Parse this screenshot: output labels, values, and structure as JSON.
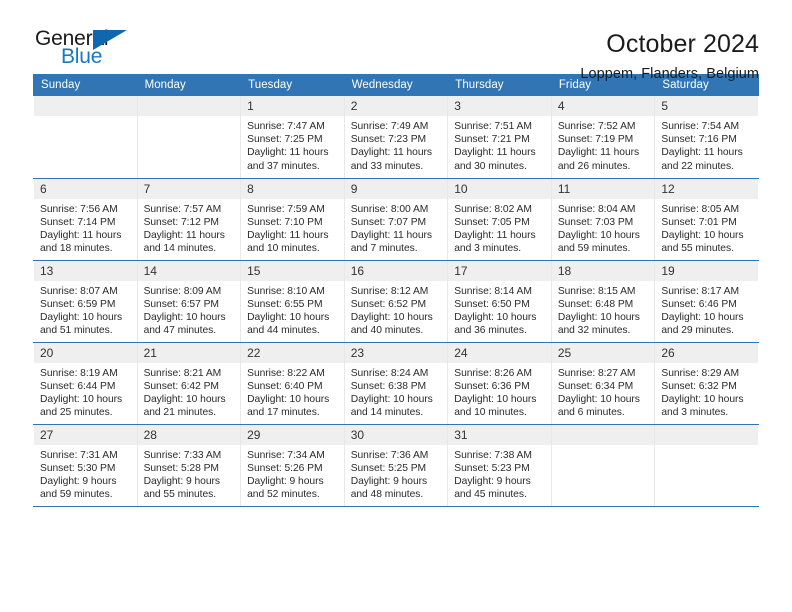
{
  "logo": {
    "word_top": "General",
    "word_bottom": "Blue",
    "triangle_color": "#1167ad",
    "blue_text_color": "#1878c8"
  },
  "header": {
    "title": "October 2024",
    "subtitle": "Loppem, Flanders, Belgium",
    "accent_color": "#3175b5"
  },
  "weekday_headers": [
    "Sunday",
    "Monday",
    "Tuesday",
    "Wednesday",
    "Thursday",
    "Friday",
    "Saturday"
  ],
  "weeks": [
    [
      {
        "day": "",
        "empty": true
      },
      {
        "day": "",
        "empty": true
      },
      {
        "day": "1",
        "sunrise": "Sunrise: 7:47 AM",
        "sunset": "Sunset: 7:25 PM",
        "daylight_1": "Daylight: 11 hours",
        "daylight_2": "and 37 minutes."
      },
      {
        "day": "2",
        "sunrise": "Sunrise: 7:49 AM",
        "sunset": "Sunset: 7:23 PM",
        "daylight_1": "Daylight: 11 hours",
        "daylight_2": "and 33 minutes."
      },
      {
        "day": "3",
        "sunrise": "Sunrise: 7:51 AM",
        "sunset": "Sunset: 7:21 PM",
        "daylight_1": "Daylight: 11 hours",
        "daylight_2": "and 30 minutes."
      },
      {
        "day": "4",
        "sunrise": "Sunrise: 7:52 AM",
        "sunset": "Sunset: 7:19 PM",
        "daylight_1": "Daylight: 11 hours",
        "daylight_2": "and 26 minutes."
      },
      {
        "day": "5",
        "sunrise": "Sunrise: 7:54 AM",
        "sunset": "Sunset: 7:16 PM",
        "daylight_1": "Daylight: 11 hours",
        "daylight_2": "and 22 minutes."
      }
    ],
    [
      {
        "day": "6",
        "sunrise": "Sunrise: 7:56 AM",
        "sunset": "Sunset: 7:14 PM",
        "daylight_1": "Daylight: 11 hours",
        "daylight_2": "and 18 minutes."
      },
      {
        "day": "7",
        "sunrise": "Sunrise: 7:57 AM",
        "sunset": "Sunset: 7:12 PM",
        "daylight_1": "Daylight: 11 hours",
        "daylight_2": "and 14 minutes."
      },
      {
        "day": "8",
        "sunrise": "Sunrise: 7:59 AM",
        "sunset": "Sunset: 7:10 PM",
        "daylight_1": "Daylight: 11 hours",
        "daylight_2": "and 10 minutes."
      },
      {
        "day": "9",
        "sunrise": "Sunrise: 8:00 AM",
        "sunset": "Sunset: 7:07 PM",
        "daylight_1": "Daylight: 11 hours",
        "daylight_2": "and 7 minutes."
      },
      {
        "day": "10",
        "sunrise": "Sunrise: 8:02 AM",
        "sunset": "Sunset: 7:05 PM",
        "daylight_1": "Daylight: 11 hours",
        "daylight_2": "and 3 minutes."
      },
      {
        "day": "11",
        "sunrise": "Sunrise: 8:04 AM",
        "sunset": "Sunset: 7:03 PM",
        "daylight_1": "Daylight: 10 hours",
        "daylight_2": "and 59 minutes."
      },
      {
        "day": "12",
        "sunrise": "Sunrise: 8:05 AM",
        "sunset": "Sunset: 7:01 PM",
        "daylight_1": "Daylight: 10 hours",
        "daylight_2": "and 55 minutes."
      }
    ],
    [
      {
        "day": "13",
        "sunrise": "Sunrise: 8:07 AM",
        "sunset": "Sunset: 6:59 PM",
        "daylight_1": "Daylight: 10 hours",
        "daylight_2": "and 51 minutes."
      },
      {
        "day": "14",
        "sunrise": "Sunrise: 8:09 AM",
        "sunset": "Sunset: 6:57 PM",
        "daylight_1": "Daylight: 10 hours",
        "daylight_2": "and 47 minutes."
      },
      {
        "day": "15",
        "sunrise": "Sunrise: 8:10 AM",
        "sunset": "Sunset: 6:55 PM",
        "daylight_1": "Daylight: 10 hours",
        "daylight_2": "and 44 minutes."
      },
      {
        "day": "16",
        "sunrise": "Sunrise: 8:12 AM",
        "sunset": "Sunset: 6:52 PM",
        "daylight_1": "Daylight: 10 hours",
        "daylight_2": "and 40 minutes."
      },
      {
        "day": "17",
        "sunrise": "Sunrise: 8:14 AM",
        "sunset": "Sunset: 6:50 PM",
        "daylight_1": "Daylight: 10 hours",
        "daylight_2": "and 36 minutes."
      },
      {
        "day": "18",
        "sunrise": "Sunrise: 8:15 AM",
        "sunset": "Sunset: 6:48 PM",
        "daylight_1": "Daylight: 10 hours",
        "daylight_2": "and 32 minutes."
      },
      {
        "day": "19",
        "sunrise": "Sunrise: 8:17 AM",
        "sunset": "Sunset: 6:46 PM",
        "daylight_1": "Daylight: 10 hours",
        "daylight_2": "and 29 minutes."
      }
    ],
    [
      {
        "day": "20",
        "sunrise": "Sunrise: 8:19 AM",
        "sunset": "Sunset: 6:44 PM",
        "daylight_1": "Daylight: 10 hours",
        "daylight_2": "and 25 minutes."
      },
      {
        "day": "21",
        "sunrise": "Sunrise: 8:21 AM",
        "sunset": "Sunset: 6:42 PM",
        "daylight_1": "Daylight: 10 hours",
        "daylight_2": "and 21 minutes."
      },
      {
        "day": "22",
        "sunrise": "Sunrise: 8:22 AM",
        "sunset": "Sunset: 6:40 PM",
        "daylight_1": "Daylight: 10 hours",
        "daylight_2": "and 17 minutes."
      },
      {
        "day": "23",
        "sunrise": "Sunrise: 8:24 AM",
        "sunset": "Sunset: 6:38 PM",
        "daylight_1": "Daylight: 10 hours",
        "daylight_2": "and 14 minutes."
      },
      {
        "day": "24",
        "sunrise": "Sunrise: 8:26 AM",
        "sunset": "Sunset: 6:36 PM",
        "daylight_1": "Daylight: 10 hours",
        "daylight_2": "and 10 minutes."
      },
      {
        "day": "25",
        "sunrise": "Sunrise: 8:27 AM",
        "sunset": "Sunset: 6:34 PM",
        "daylight_1": "Daylight: 10 hours",
        "daylight_2": "and 6 minutes."
      },
      {
        "day": "26",
        "sunrise": "Sunrise: 8:29 AM",
        "sunset": "Sunset: 6:32 PM",
        "daylight_1": "Daylight: 10 hours",
        "daylight_2": "and 3 minutes."
      }
    ],
    [
      {
        "day": "27",
        "sunrise": "Sunrise: 7:31 AM",
        "sunset": "Sunset: 5:30 PM",
        "daylight_1": "Daylight: 9 hours",
        "daylight_2": "and 59 minutes."
      },
      {
        "day": "28",
        "sunrise": "Sunrise: 7:33 AM",
        "sunset": "Sunset: 5:28 PM",
        "daylight_1": "Daylight: 9 hours",
        "daylight_2": "and 55 minutes."
      },
      {
        "day": "29",
        "sunrise": "Sunrise: 7:34 AM",
        "sunset": "Sunset: 5:26 PM",
        "daylight_1": "Daylight: 9 hours",
        "daylight_2": "and 52 minutes."
      },
      {
        "day": "30",
        "sunrise": "Sunrise: 7:36 AM",
        "sunset": "Sunset: 5:25 PM",
        "daylight_1": "Daylight: 9 hours",
        "daylight_2": "and 48 minutes."
      },
      {
        "day": "31",
        "sunrise": "Sunrise: 7:38 AM",
        "sunset": "Sunset: 5:23 PM",
        "daylight_1": "Daylight: 9 hours",
        "daylight_2": "and 45 minutes."
      },
      {
        "day": "",
        "empty": true
      },
      {
        "day": "",
        "empty": true
      }
    ]
  ]
}
